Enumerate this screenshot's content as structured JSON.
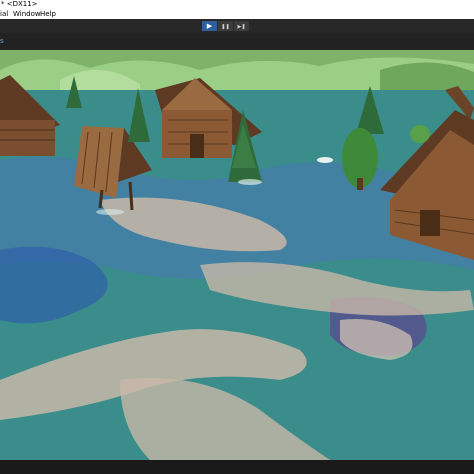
{
  "window": {
    "title": "* <DX11>"
  },
  "menu": {
    "items": [
      "ial",
      "Window",
      "Help"
    ]
  },
  "toolbar": {
    "play_icon": "play-icon",
    "pause_icon": "pause-icon",
    "step_icon": "step-icon",
    "play_glyph": "▶",
    "pause_glyph": "❚❚",
    "step_glyph": "▶❚",
    "active_color": "#2f5fa0"
  },
  "game_view": {
    "tab_fragment": "s",
    "scene_colors": {
      "water": "#3a8d8b",
      "sand": "#c8b8a8",
      "shadow_water": "#2e5fa8",
      "hills": "#8fc27a",
      "wood": "#7a4e2e",
      "roof": "#5e3a22",
      "tree": "#2f6b3a"
    }
  }
}
